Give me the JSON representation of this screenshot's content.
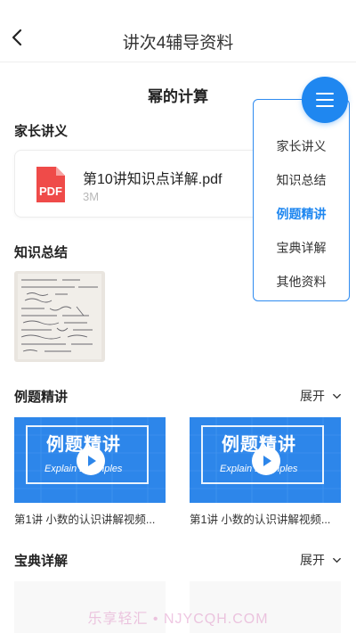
{
  "header": {
    "title": "讲次4辅导资料"
  },
  "section_title": "幂的计算",
  "parent_notes": {
    "heading": "家长讲义",
    "file": {
      "name": "第10讲知识点详解.pdf",
      "size": "3M",
      "icon_label": "PDF"
    }
  },
  "knowledge": {
    "heading": "知识总结"
  },
  "examples": {
    "heading": "例题精讲",
    "expand_label": "展开",
    "videos": [
      {
        "caption": "第1讲  小数的认识讲解视频...",
        "banner_cn": "例题精讲",
        "banner_en": "Explain Examples"
      },
      {
        "caption": "第1讲  小数的认识讲解视频...",
        "banner_cn": "例题精讲",
        "banner_en": "Explain Examples"
      }
    ]
  },
  "treasure": {
    "heading": "宝典详解",
    "expand_label": "展开"
  },
  "menu": {
    "items": [
      {
        "label": "家长讲义",
        "active": false
      },
      {
        "label": "知识总结",
        "active": false
      },
      {
        "label": "例题精讲",
        "active": true
      },
      {
        "label": "宝典详解",
        "active": false
      },
      {
        "label": "其他资料",
        "active": false
      }
    ]
  },
  "watermark": "乐享轻汇 • NJYCQH.COM",
  "colors": {
    "accent": "#1f87f0",
    "pdf_red": "#ef4b49"
  }
}
